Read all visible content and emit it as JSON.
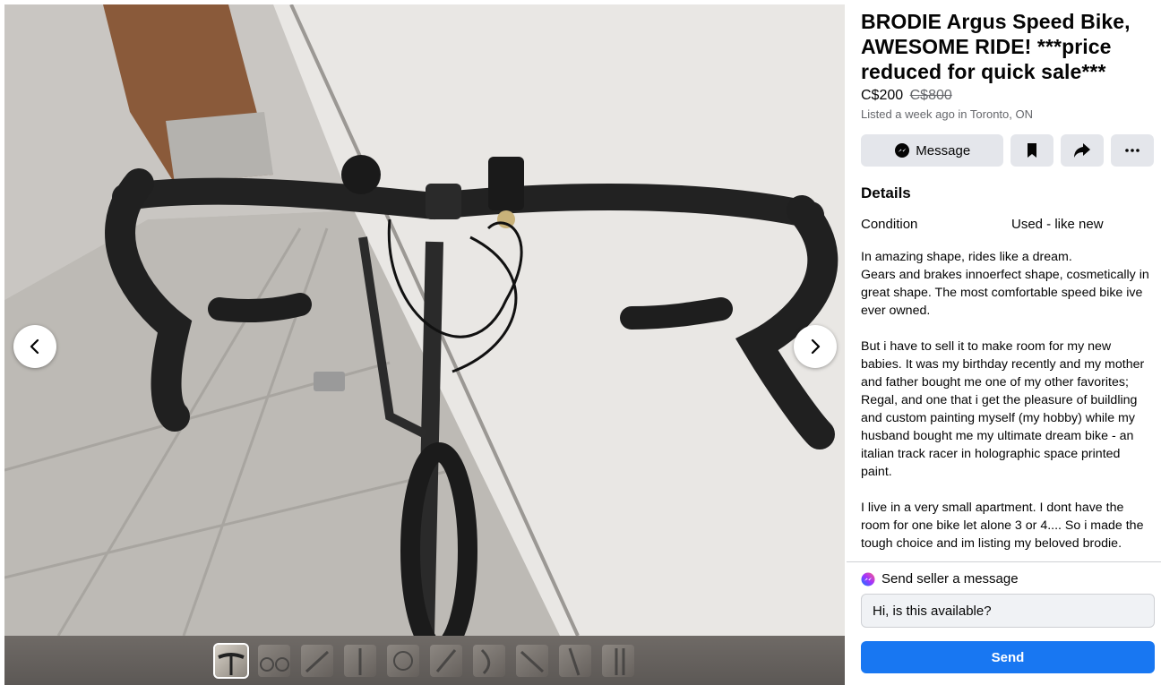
{
  "listing": {
    "title": "BRODIE Argus Speed Bike, AWESOME RIDE! ***price reduced for quick sale***",
    "price": "C$200",
    "original_price": "C$800",
    "listed_text": "Listed a week ago in Toronto, ON"
  },
  "actions": {
    "message_label": "Message",
    "message_icon": "messenger-icon",
    "save_icon": "bookmark-icon",
    "share_icon": "share-icon",
    "more_icon": "more-icon"
  },
  "details": {
    "heading": "Details",
    "condition_label": "Condition",
    "condition_value": "Used - like new",
    "description": "In amazing shape, rides like a dream.\nGears and brakes innoerfect shape, cosmetically in great shape. The most comfortable speed bike ive ever owned.\n\nBut i have to sell it to make room for my new babies. It was my birthday recently and my mother and father bought me one of my other favorites; Regal, and one that i get the pleasure of buildling and custom painting myself (my hobby) while my husband bought me my ultimate dream bike - an italian track racer in holographic space printed paint.\n\nI live in a very small apartment. I dont have the room for one bike let alone 3 or 4.... So i made the tough choice and im listing my beloved brodie."
  },
  "send": {
    "header": "Send seller a message",
    "input_value": "Hi, is this available?",
    "button_label": "Send"
  },
  "gallery": {
    "thumbnail_count": 10,
    "active_index": 0
  },
  "colors": {
    "primary_blue": "#1877f2",
    "button_gray": "#e4e6eb",
    "secondary_text": "#65676b"
  }
}
